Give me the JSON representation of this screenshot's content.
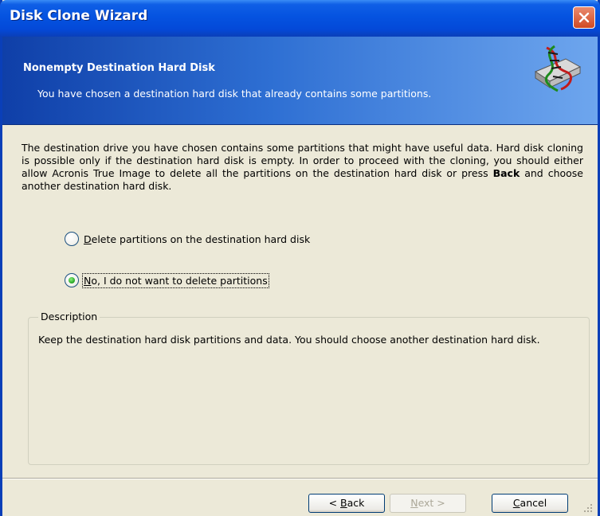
{
  "window": {
    "title": "Disk Clone Wizard"
  },
  "header": {
    "title": "Nonempty Destination Hard Disk",
    "subtitle": "You have chosen a destination hard disk that already contains some partitions.",
    "icon": "disk-clone-icon"
  },
  "main": {
    "text_before_bold": "The destination drive you have chosen contains some partitions that might have useful data. Hard disk cloning is possible only if the destination hard disk is empty. In order to proceed with the cloning, you should either allow Acronis True Image to delete all the partitions on the destination hard disk or press ",
    "bold": "Back",
    "text_after_bold": " and choose another destination hard disk."
  },
  "options": [
    {
      "mnemonic": "D",
      "rest": "elete partitions on the destination hard disk",
      "selected": false
    },
    {
      "mnemonic": "N",
      "rest": "o, I do not want to delete partitions",
      "selected": true
    }
  ],
  "description": {
    "legend": "Description",
    "text": "Keep the destination hard disk partitions and data. You should choose another destination hard disk."
  },
  "buttons": {
    "back": {
      "pre": "< ",
      "mnemonic": "B",
      "rest": "ack"
    },
    "next": {
      "pre": "",
      "mnemonic": "N",
      "rest": "ext >"
    },
    "cancel": {
      "pre": "",
      "mnemonic": "C",
      "rest": "ancel"
    }
  },
  "colors": {
    "title_bar": "#0553e0",
    "selected_radio": "#21a121",
    "close_button": "#d14a24"
  }
}
